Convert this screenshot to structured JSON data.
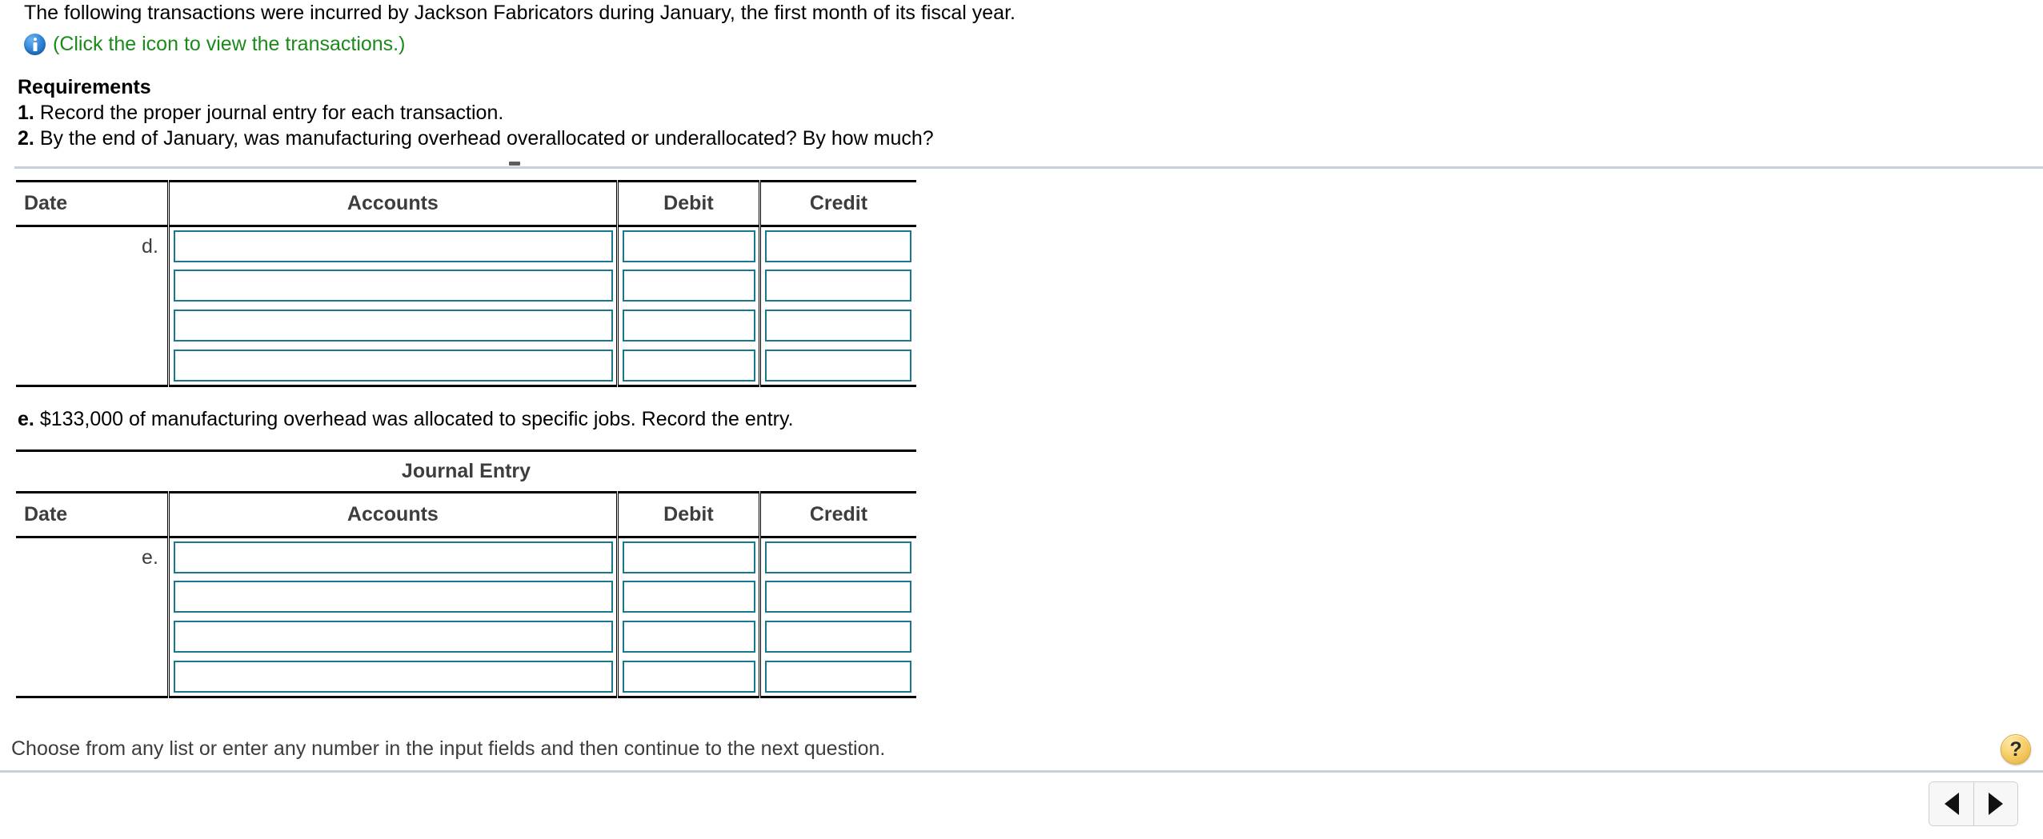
{
  "problem": {
    "statement": "The following transactions were incurred by Jackson Fabricators during January, the first month of its fiscal year.",
    "icon_link": "(Click the icon to view the transactions.)",
    "info_icon": "info-icon"
  },
  "requirements": {
    "heading": "Requirements",
    "items": [
      {
        "num": "1.",
        "text": "Record the proper journal entry for each transaction."
      },
      {
        "num": "2.",
        "text": "By the end of January, was manufacturing overhead overallocated or underallocated? By how much?"
      }
    ]
  },
  "tables": [
    {
      "id": "table-d",
      "title": "Journal Entry",
      "title_visible": false,
      "columns": [
        "Date",
        "Accounts",
        "Debit",
        "Credit"
      ],
      "rows": [
        {
          "date": "d.",
          "accounts": "",
          "debit": "",
          "credit": ""
        },
        {
          "date": "",
          "accounts": "",
          "debit": "",
          "credit": ""
        },
        {
          "date": "",
          "accounts": "",
          "debit": "",
          "credit": ""
        },
        {
          "date": "",
          "accounts": "",
          "debit": "",
          "credit": ""
        }
      ]
    },
    {
      "id": "table-e",
      "title": "Journal Entry",
      "title_visible": true,
      "columns": [
        "Date",
        "Accounts",
        "Debit",
        "Credit"
      ],
      "rows": [
        {
          "date": "e.",
          "accounts": "",
          "debit": "",
          "credit": ""
        },
        {
          "date": "",
          "accounts": "",
          "debit": "",
          "credit": ""
        },
        {
          "date": "",
          "accounts": "",
          "debit": "",
          "credit": ""
        },
        {
          "date": "",
          "accounts": "",
          "debit": "",
          "credit": ""
        }
      ]
    }
  ],
  "e_sentence": {
    "label": "e.",
    "text": "$133,000 of manufacturing overhead was allocated to specific jobs. Record the entry."
  },
  "footer": {
    "note": "Choose from any list or enter any number in the input fields and then continue to the next question.",
    "help_label": "?",
    "prev_label": "previous-question",
    "next_label": "next-question"
  },
  "colors": {
    "link_green": "#1a8a1a",
    "input_border_teal": "#17788f",
    "divider_gray": "#c9cedb",
    "help_gold": "#f6cf68"
  }
}
